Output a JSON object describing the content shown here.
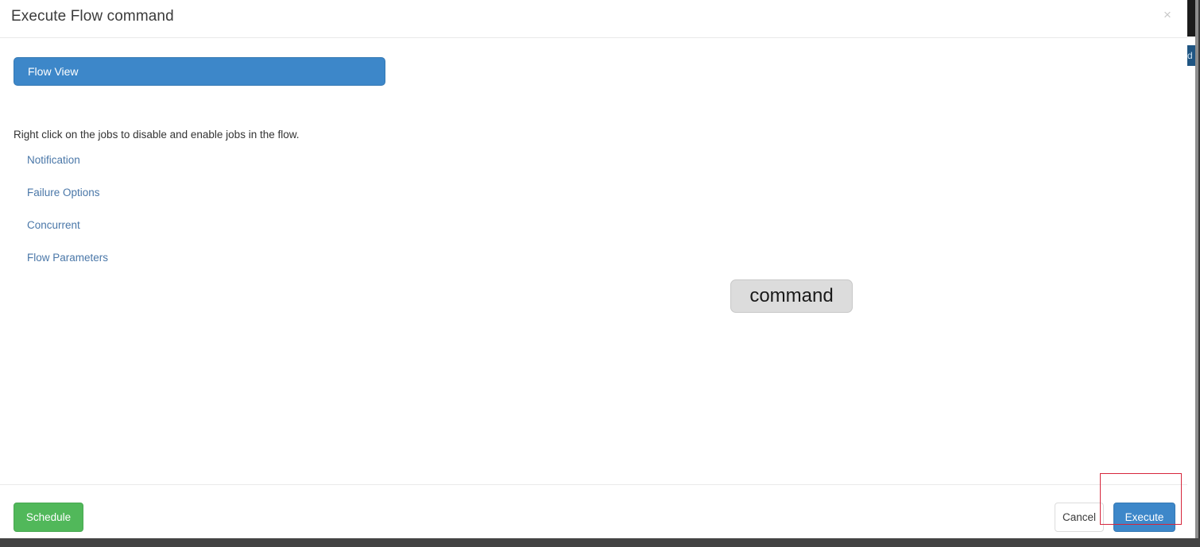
{
  "modal": {
    "title": "Execute Flow command",
    "close_label": "×",
    "close_icon": "close-icon"
  },
  "body": {
    "flow_tab": {
      "label": "Flow View"
    },
    "hint": "Right click on the jobs to disable and enable jobs in the flow.",
    "links": [
      {
        "label": "Notification"
      },
      {
        "label": "Failure Options"
      },
      {
        "label": "Concurrent"
      },
      {
        "label": "Flow Parameters"
      }
    ],
    "graph": {
      "nodes": [
        {
          "label": "command"
        }
      ]
    }
  },
  "footer": {
    "schedule_label": "Schedule",
    "cancel_label": "Cancel",
    "execute_label": "Execute"
  },
  "background": {
    "hidden_fragment_text": "d"
  },
  "colors": {
    "primary_blue": "#3d87c9",
    "green": "#51b85a",
    "link_blue": "#4a77a8",
    "node_gray": "#dcdcdc",
    "annotation_red": "#d6263c"
  }
}
